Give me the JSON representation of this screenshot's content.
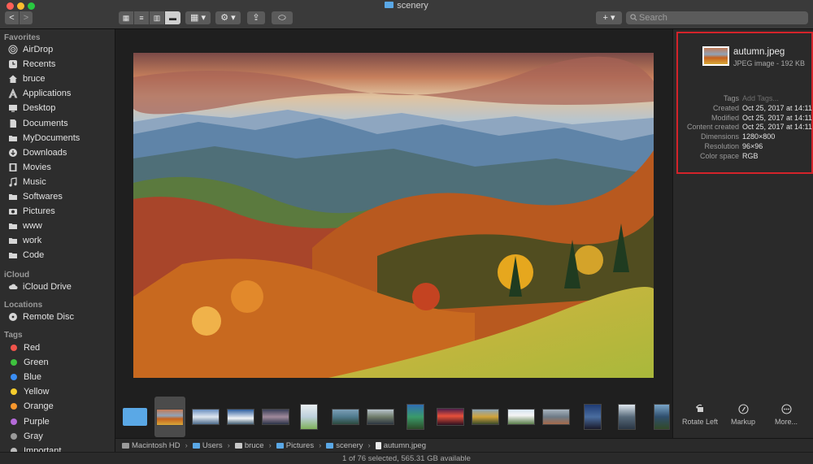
{
  "window": {
    "title": "scenery"
  },
  "toolbar": {
    "back_glyph": "<",
    "forward_glyph": ">",
    "group_glyph": "▦ ▾",
    "action_glyph": "⚙ ▾",
    "share_glyph": "⇪",
    "tag_glyph": "⬭",
    "add_glyph": "+ ▾",
    "search_placeholder": "Search"
  },
  "sidebar": {
    "favorites_heading": "Favorites",
    "favorites": [
      {
        "label": "AirDrop",
        "icon": "airdrop-icon"
      },
      {
        "label": "Recents",
        "icon": "clock-icon"
      },
      {
        "label": "bruce",
        "icon": "home-icon"
      },
      {
        "label": "Applications",
        "icon": "applications-icon"
      },
      {
        "label": "Desktop",
        "icon": "desktop-icon"
      },
      {
        "label": "Documents",
        "icon": "document-icon"
      },
      {
        "label": "MyDocuments",
        "icon": "folder-icon"
      },
      {
        "label": "Downloads",
        "icon": "download-icon"
      },
      {
        "label": "Movies",
        "icon": "film-icon"
      },
      {
        "label": "Music",
        "icon": "music-icon"
      },
      {
        "label": "Softwares",
        "icon": "folder-icon"
      },
      {
        "label": "Pictures",
        "icon": "camera-icon"
      },
      {
        "label": "www",
        "icon": "folder-icon"
      },
      {
        "label": "work",
        "icon": "folder-icon"
      },
      {
        "label": "Code",
        "icon": "folder-icon"
      }
    ],
    "icloud_heading": "iCloud",
    "icloud": [
      {
        "label": "iCloud Drive",
        "icon": "cloud-icon"
      }
    ],
    "locations_heading": "Locations",
    "locations": [
      {
        "label": "Remote Disc",
        "icon": "disc-icon"
      }
    ],
    "tags_heading": "Tags",
    "tags": [
      {
        "label": "Red",
        "color": "#f0544b"
      },
      {
        "label": "Green",
        "color": "#3ec23e"
      },
      {
        "label": "Blue",
        "color": "#3a8ef5"
      },
      {
        "label": "Yellow",
        "color": "#f5cc2d"
      },
      {
        "label": "Orange",
        "color": "#f7972d"
      },
      {
        "label": "Purple",
        "color": "#b46ad8"
      },
      {
        "label": "Gray",
        "color": "#9a9a9a"
      },
      {
        "label": "Important",
        "color": "#bdbdbd"
      }
    ]
  },
  "pathbar": [
    {
      "label": "Macintosh HD",
      "icon": "disk"
    },
    {
      "label": "Users",
      "icon": "folder"
    },
    {
      "label": "bruce",
      "icon": "home"
    },
    {
      "label": "Pictures",
      "icon": "folder"
    },
    {
      "label": "scenery",
      "icon": "folder"
    },
    {
      "label": "autumn.jpeg",
      "icon": "file"
    }
  ],
  "status": {
    "text": "1 of 76 selected, 565.31 GB available"
  },
  "inspector": {
    "file_name": "autumn.jpeg",
    "file_kind": "JPEG image - 192 KB",
    "metadata": [
      {
        "key": "Tags",
        "value": "Add Tags...",
        "placeholder": true
      },
      {
        "key": "Created",
        "value": "Oct 25, 2017 at 14:11"
      },
      {
        "key": "Modified",
        "value": "Oct 25, 2017 at 14:11"
      },
      {
        "key": "Content created",
        "value": "Oct 25, 2017 at 14:11"
      },
      {
        "key": "Dimensions",
        "value": "1280×800"
      },
      {
        "key": "Resolution",
        "value": "96×96"
      },
      {
        "key": "Color space",
        "value": "RGB"
      }
    ],
    "quick_actions": [
      {
        "label": "Rotate Left",
        "icon": "rotate-left-icon"
      },
      {
        "label": "Markup",
        "icon": "markup-icon"
      },
      {
        "label": "More...",
        "icon": "more-icon"
      }
    ]
  },
  "colors": {
    "selection_border": "#d4232a",
    "accent": "#5aa8e6"
  }
}
